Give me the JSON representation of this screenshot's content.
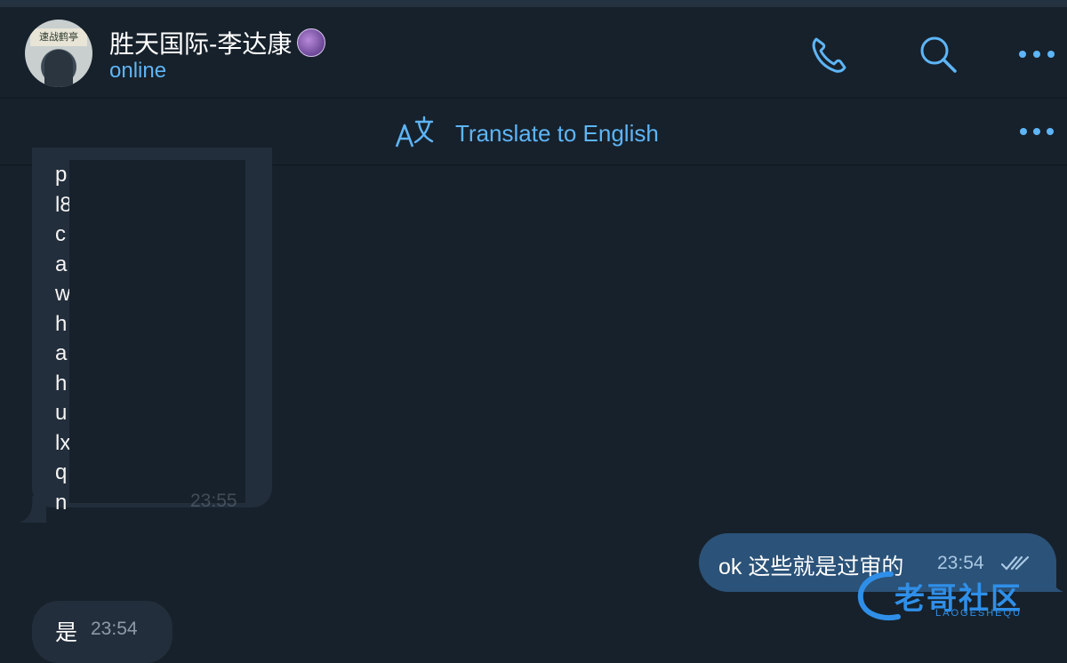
{
  "header": {
    "contact_name": "胜天国际-李达康",
    "status": "online",
    "avatar_banner": "速战鹤亭",
    "icons": [
      "phone-icon",
      "search-icon",
      "more-icon"
    ]
  },
  "translate_bar": {
    "label": "Translate to English",
    "icon": "translate-icon",
    "more_icon": "more-icon"
  },
  "messages": {
    "incoming_large": {
      "visible_letters": [
        "p",
        "l8",
        "c",
        "a",
        "w",
        "h",
        "a",
        "h",
        "u",
        "lx",
        "q",
        "n"
      ],
      "time": "23:55"
    },
    "outgoing": {
      "text": "ok 这些就是过审的",
      "time": "23:54",
      "status_icon": "double-check-icon"
    },
    "incoming_small": {
      "text": "是",
      "time": "23:54"
    }
  },
  "watermark": {
    "text": "老哥社区",
    "sub": "LAOGESHEQU"
  },
  "colors": {
    "background": "#17212b",
    "accent": "#5eb5f7",
    "incoming_bubble": "#232e3c",
    "outgoing_bubble": "#2b5278"
  }
}
